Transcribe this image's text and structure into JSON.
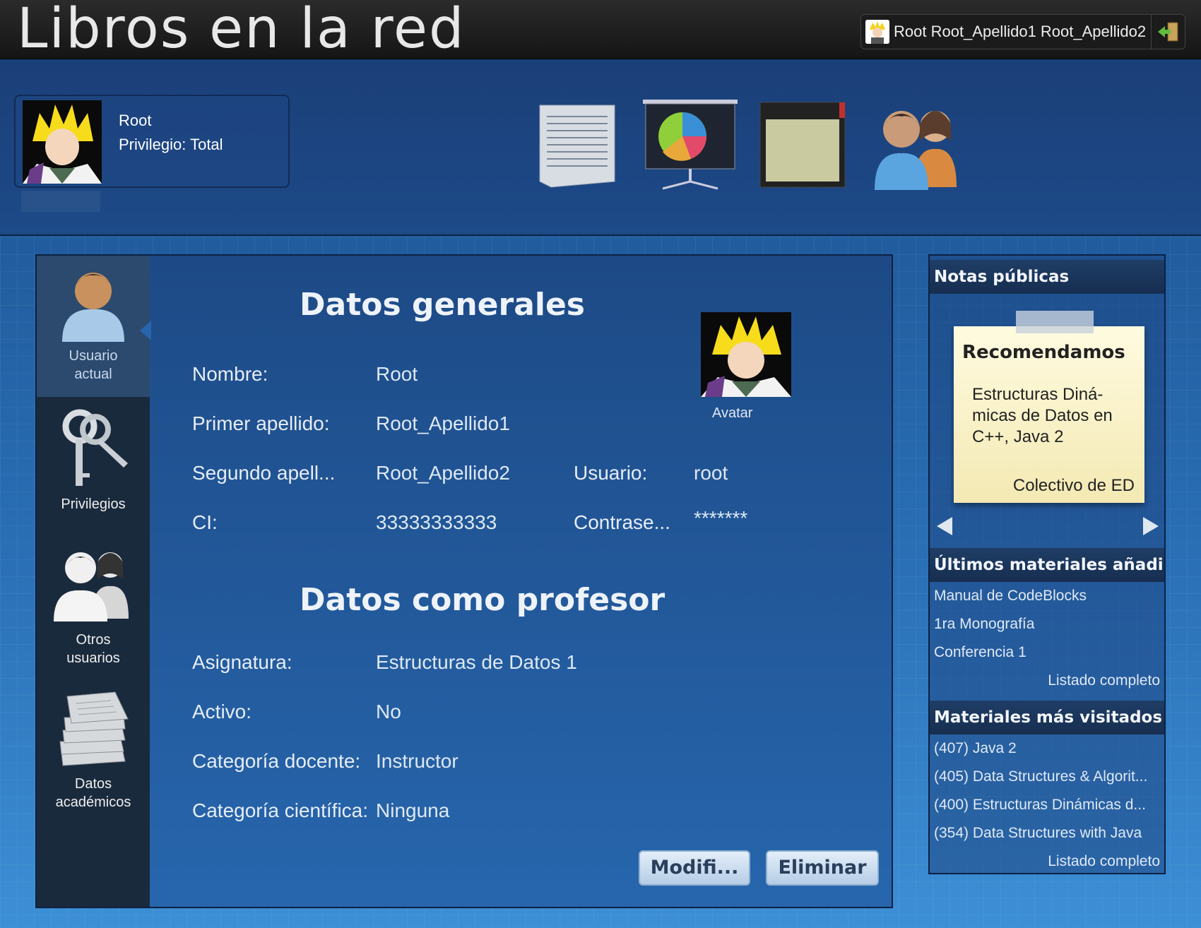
{
  "app": {
    "title": "Libros en la red"
  },
  "topbar": {
    "user_full_name": "Root Root_Apellido1 Root_Apellido2"
  },
  "profile": {
    "name": "Root",
    "privilege": "Privilegio: Total"
  },
  "nav_icons": [
    "document-icon",
    "presentation-chart-icon",
    "notebook-icon",
    "users-icon"
  ],
  "sidebar": {
    "items": [
      {
        "label": "Usuario actual",
        "icon": "user-icon",
        "active": true
      },
      {
        "label": "Privilegios",
        "icon": "keys-icon"
      },
      {
        "label": "Otros usuarios",
        "icon": "users-icon"
      },
      {
        "label": "Datos académicos",
        "icon": "papers-icon"
      }
    ]
  },
  "general": {
    "heading": "Datos generales",
    "nombre_label": "Nombre:",
    "nombre": "Root",
    "apellido1_label": "Primer apellido:",
    "apellido1": "Root_Apellido1",
    "apellido2_label": "Segundo apell...",
    "apellido2": "Root_Apellido2",
    "ci_label": "CI:",
    "ci": "33333333333",
    "usuario_label": "Usuario:",
    "usuario": "root",
    "pass_label": "Contrase...",
    "pass": "*******",
    "avatar_label": "Avatar"
  },
  "profesor": {
    "heading": "Datos como profesor",
    "asignatura_label": "Asignatura:",
    "asignatura": "Estructuras de Datos 1",
    "activo_label": "Activo:",
    "activo": "No",
    "cat_docente_label": "Categoría docente:",
    "cat_docente": "Instructor",
    "cat_cientifica_label": "Categoría científica:",
    "cat_cientifica": "Ninguna"
  },
  "buttons": {
    "modify": "Modifi...",
    "delete": "Eliminar"
  },
  "right": {
    "notes_heading": "Notas públicas",
    "note": {
      "title": "Recomendamos",
      "body": "Estructuras Diná-micas de Datos en C++, Java 2",
      "author": "Colectivo de ED"
    },
    "latest_heading": "Últimos materiales añadi...",
    "latest": [
      "Manual de CodeBlocks",
      "1ra Monografía",
      "Conferencia 1"
    ],
    "latest_more": "Listado completo",
    "visited_heading": "Materiales más visitados",
    "visited": [
      "(407) Java 2",
      "(405) Data Structures & Algorit...",
      "(400) Estructuras Dinámicas d...",
      "(354) Data Structures with Java"
    ],
    "visited_more": "Listado completo"
  }
}
